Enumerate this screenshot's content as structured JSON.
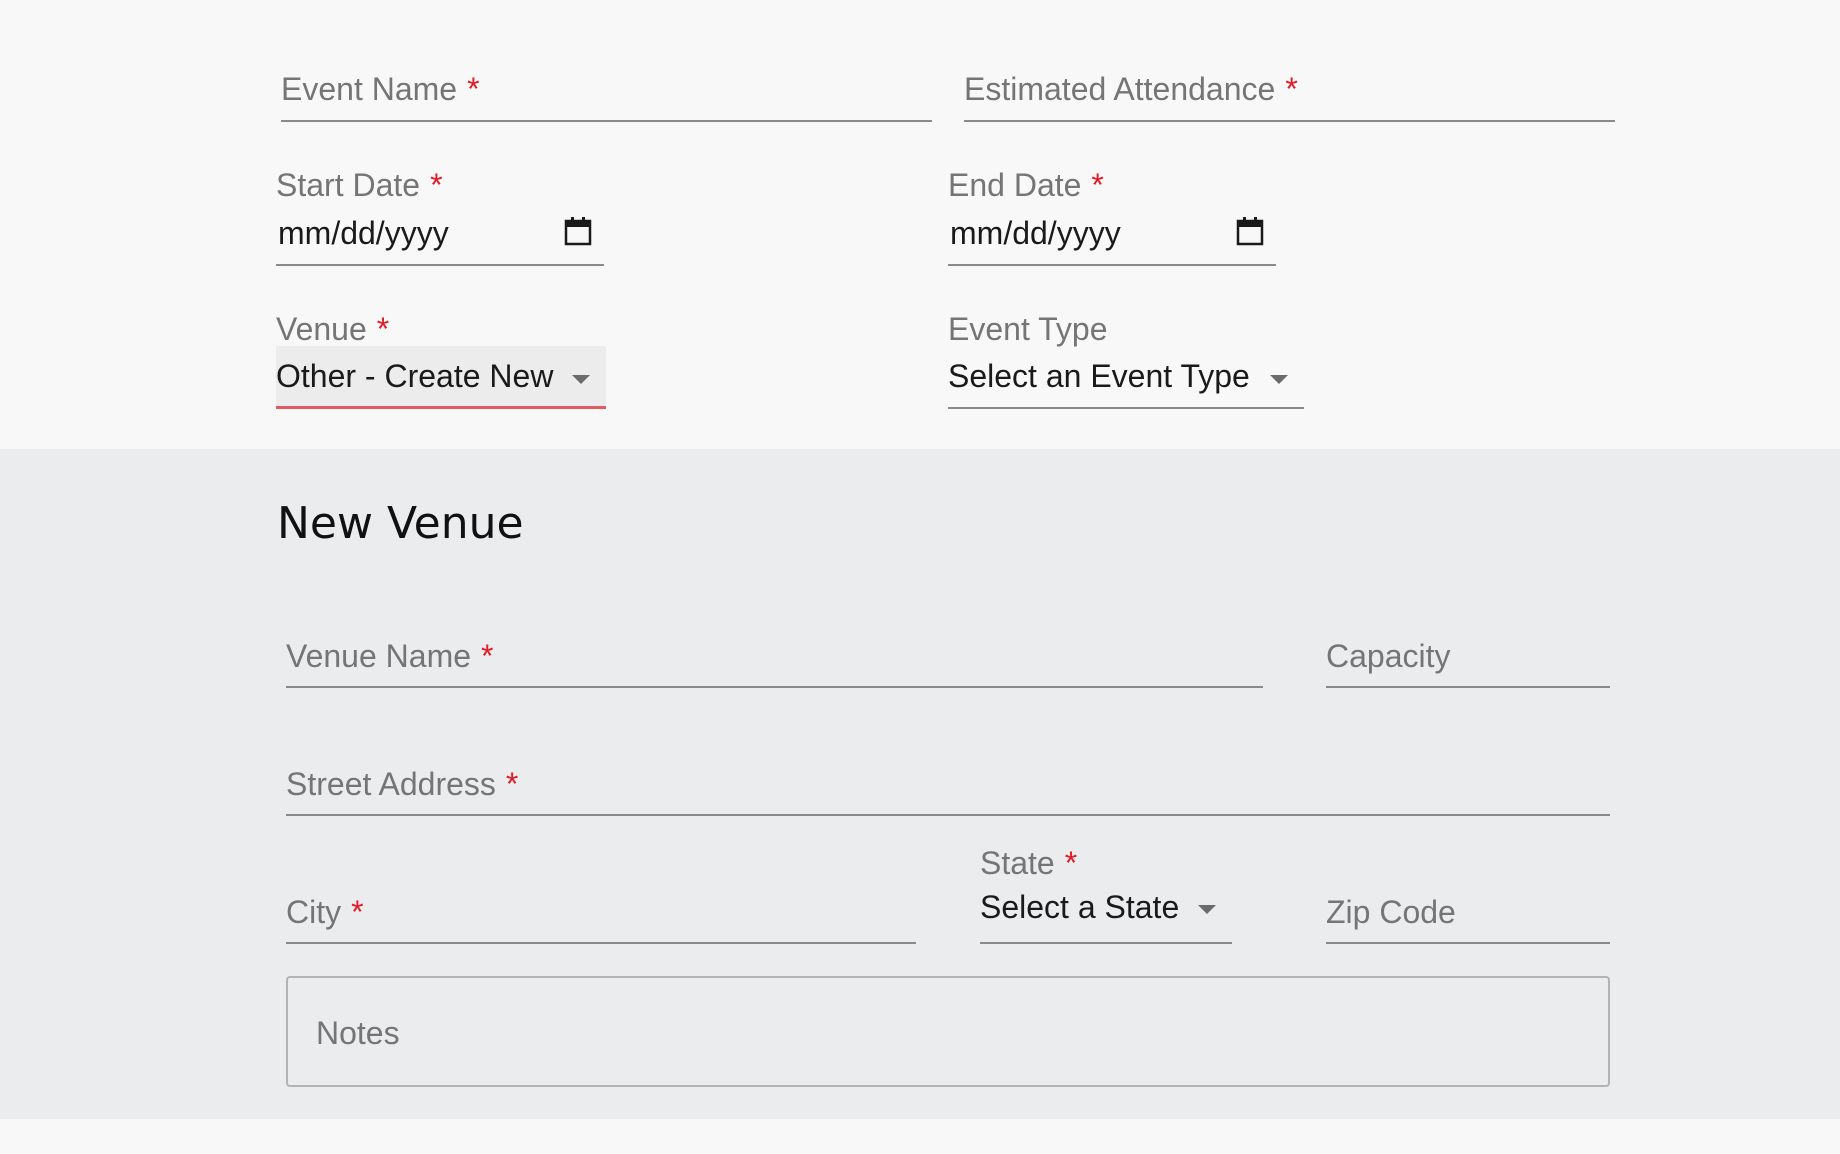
{
  "event": {
    "event_name": {
      "label": "Event Name",
      "required": "*"
    },
    "estimated_attendance": {
      "label": "Estimated Attendance",
      "required": "*"
    },
    "start_date": {
      "label": "Start Date",
      "required": "*",
      "placeholder": "mm/dd/yyyy"
    },
    "end_date": {
      "label": "End Date",
      "required": "*",
      "placeholder": "mm/dd/yyyy"
    },
    "venue": {
      "label": "Venue",
      "required": "*",
      "value": "Other - Create New"
    },
    "event_type": {
      "label": "Event Type",
      "value": "Select an Event Type"
    }
  },
  "new_venue": {
    "title": "New Venue",
    "venue_name": {
      "label": "Venue Name",
      "required": "*"
    },
    "capacity": {
      "label": "Capacity"
    },
    "street_address": {
      "label": "Street Address",
      "required": "*"
    },
    "city": {
      "label": "City",
      "required": "*"
    },
    "state": {
      "label": "State",
      "required": "*",
      "value": "Select a State"
    },
    "zip_code": {
      "label": "Zip Code"
    },
    "notes": {
      "label": "Notes"
    }
  },
  "colors": {
    "required": "#e21b24",
    "venue_underline_active": "#e05a5f",
    "section_bg": "#ebecee",
    "page_bg": "#f8f8f8"
  },
  "icons": {
    "calendar": "calendar-icon",
    "dropdown": "chevron-down-icon"
  }
}
